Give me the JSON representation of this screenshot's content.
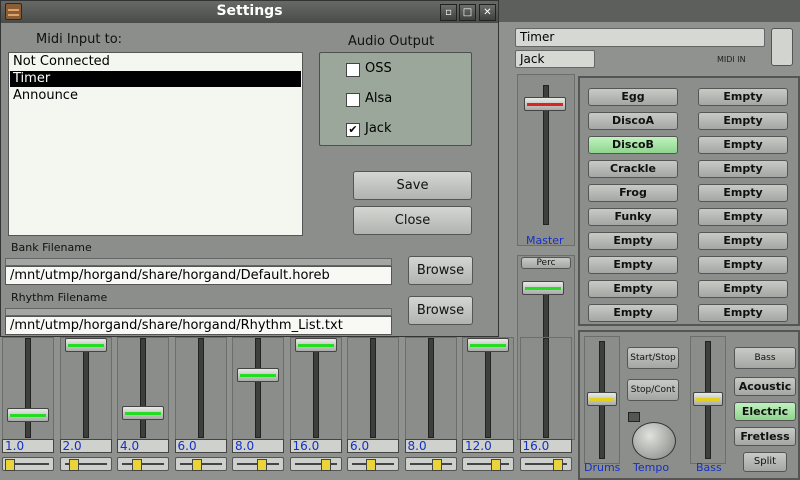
{
  "synth": {
    "timer_field": "Timer",
    "jack_field": "Jack",
    "midi_in_label": "MIDI IN",
    "master_label": "Master",
    "perc_label": "Perc",
    "presets_left": [
      "Egg",
      "DiscoA",
      "DiscoB",
      "Crackle",
      "Frog",
      "Funky",
      "Empty",
      "Empty",
      "Empty",
      "Empty"
    ],
    "presets_right": [
      "Empty",
      "Empty",
      "Empty",
      "Empty",
      "Empty",
      "Empty",
      "Empty",
      "Empty",
      "Empty",
      "Empty"
    ],
    "active_preset": "DiscoB",
    "drawbar_values": [
      "1.0",
      "2.0",
      "4.0",
      "6.0",
      "8.0",
      "16.0",
      "6.0",
      "8.0",
      "12.0",
      "16.0"
    ],
    "rhythm": {
      "start_stop": "Start/Stop",
      "stop_cont": "Stop/Cont",
      "drums_label": "Drums",
      "tempo_label": "Tempo",
      "bass_label": "Bass",
      "bass_header": "Bass",
      "bass_acoustic": "Acoustic",
      "bass_electric": "Electric",
      "bass_fretless": "Fretless",
      "split": "Split"
    }
  },
  "dialog": {
    "title": "Settings",
    "midi_input_label": "Midi Input to:",
    "midi_options": [
      "Not Connected",
      "Timer",
      "Announce"
    ],
    "midi_selected": "Timer",
    "audio_output_label": "Audio Output",
    "audio_options": [
      {
        "label": "OSS",
        "checked": false
      },
      {
        "label": "Alsa",
        "checked": false
      },
      {
        "label": "Jack",
        "checked": true
      }
    ],
    "save_label": "Save",
    "close_label": "Close",
    "bank_filename_label": "Bank Filename",
    "bank_filename_value": "/mnt/utmp/horgand/share/horgand/Default.horeb",
    "rhythm_filename_label": "Rhythm Filename",
    "rhythm_filename_value": "/mnt/utmp/horgand/share/horgand/Rhythm_List.txt",
    "browse_label": "Browse",
    "window_buttons": {
      "minimize": "▫",
      "maximize": "□",
      "close": "✕"
    }
  },
  "colors": {
    "selected_bg": "#000000",
    "active_preset": "#a8e6a6",
    "value_text": "#1530c8",
    "green_line": "#22dd22",
    "yellow_line": "#e0d020",
    "red_line": "#dd2222"
  }
}
